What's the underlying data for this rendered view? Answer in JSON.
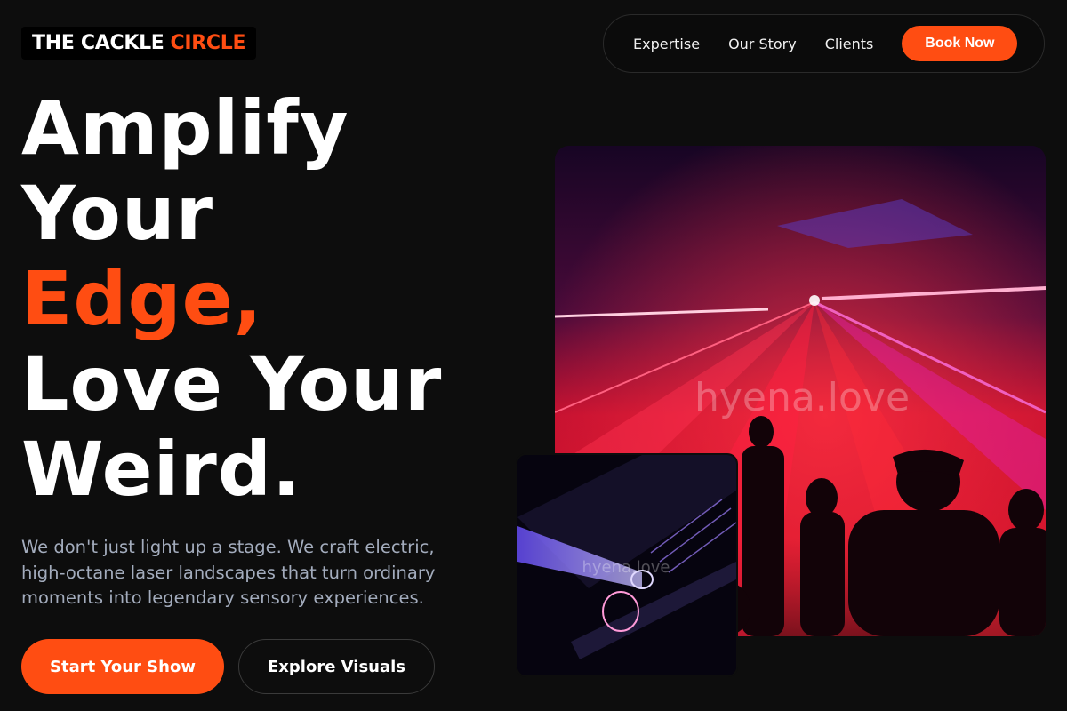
{
  "brand": {
    "part1": "THE CACKLE",
    "part2": "CIRCLE"
  },
  "nav": {
    "links": [
      "Expertise",
      "Our Story",
      "Clients"
    ],
    "cta": "Book Now"
  },
  "hero": {
    "lines": [
      "Amplify",
      "Your",
      "Edge,",
      "Love Your",
      "Weird."
    ],
    "subtext": "We don't just light up a stage. We craft electric, high-octane laser landscapes that turn ordinary moments into legendary sensory experiences.",
    "primary_button": "Start Your Show",
    "secondary_button": "Explore Visuals"
  },
  "images": {
    "main_watermark": "hyena.love",
    "small_watermark": "hyena.love"
  },
  "colors": {
    "accent": "#ff4d12",
    "background": "#0d0d0d",
    "subtext": "#a3acbd"
  }
}
